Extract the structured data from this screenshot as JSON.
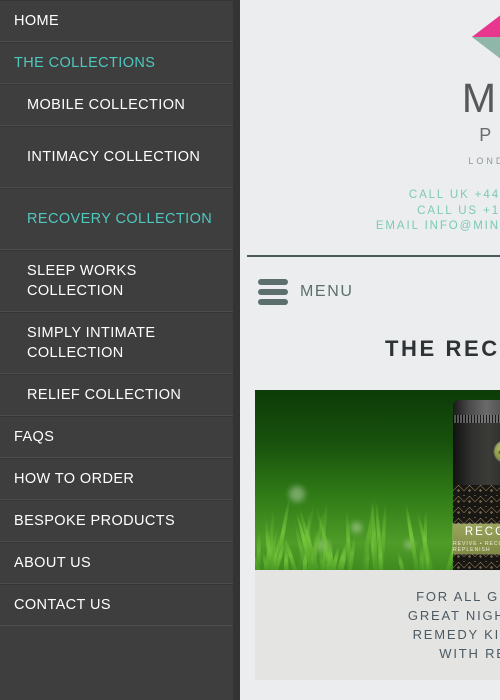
{
  "sidebar": {
    "items": [
      {
        "label": "HOME",
        "level": "top",
        "state": "default"
      },
      {
        "label": "THE COLLECTIONS",
        "level": "top",
        "state": "active"
      },
      {
        "label": "MOBILE COLLECTION",
        "level": "sub",
        "state": "default"
      },
      {
        "label": "INTIMACY COLLECTION",
        "level": "sub",
        "state": "default"
      },
      {
        "label": "RECOVERY COLLECTION",
        "level": "sub",
        "state": "active"
      },
      {
        "label": "SLEEP WORKS COLLECTION",
        "level": "sub",
        "state": "default"
      },
      {
        "label": "SIMPLY INTIMATE COLLECTION",
        "level": "sub",
        "state": "default"
      },
      {
        "label": "RELIEF COLLECTION",
        "level": "sub",
        "state": "default"
      },
      {
        "label": "FAQS",
        "level": "top",
        "state": "default"
      },
      {
        "label": "HOW TO ORDER",
        "level": "top",
        "state": "default"
      },
      {
        "label": "BESPOKE PRODUCTS",
        "level": "top",
        "state": "default"
      },
      {
        "label": "ABOUT US",
        "level": "top",
        "state": "default"
      },
      {
        "label": "CONTACT US",
        "level": "top",
        "state": "default"
      }
    ]
  },
  "header": {
    "logo_icon": "cube-diamond-logo-icon",
    "logo_name": "MIN",
    "logo_subtitle": "PRO",
    "locations": "LONDON  •  N",
    "contact": {
      "uk_label": "CALL UK",
      "uk_value": "+44",
      "us_label": "CALL US",
      "us_value": "+1",
      "email_label": "EMAIL",
      "email_value": "INFO@MIN"
    }
  },
  "menubar": {
    "icon": "hamburger-menu-icon",
    "label": "MENU"
  },
  "main": {
    "page_title": "THE RECOVER",
    "product": {
      "image_alt": "recovery-tin-on-grass",
      "label_title": "RECOVERY",
      "label_tagline": "REVIVE • RECOVER • REPLENISH"
    },
    "body_lines": [
      "FOR ALL GUESTS WHO",
      "GREAT NIGHT OUT, WE'V",
      "REMEDY KIT TO HELP T",
      "WITH REVIVED E"
    ]
  },
  "colors": {
    "sidebar_bg": "#3e3e3e",
    "sidebar_active": "#4fc8bf",
    "page_bg": "#ebedee",
    "accent_teal": "#79c9b5",
    "logo_pink": "#e8368f",
    "logo_teal": "#56c5b0",
    "card_bg": "#e4e4e2"
  }
}
